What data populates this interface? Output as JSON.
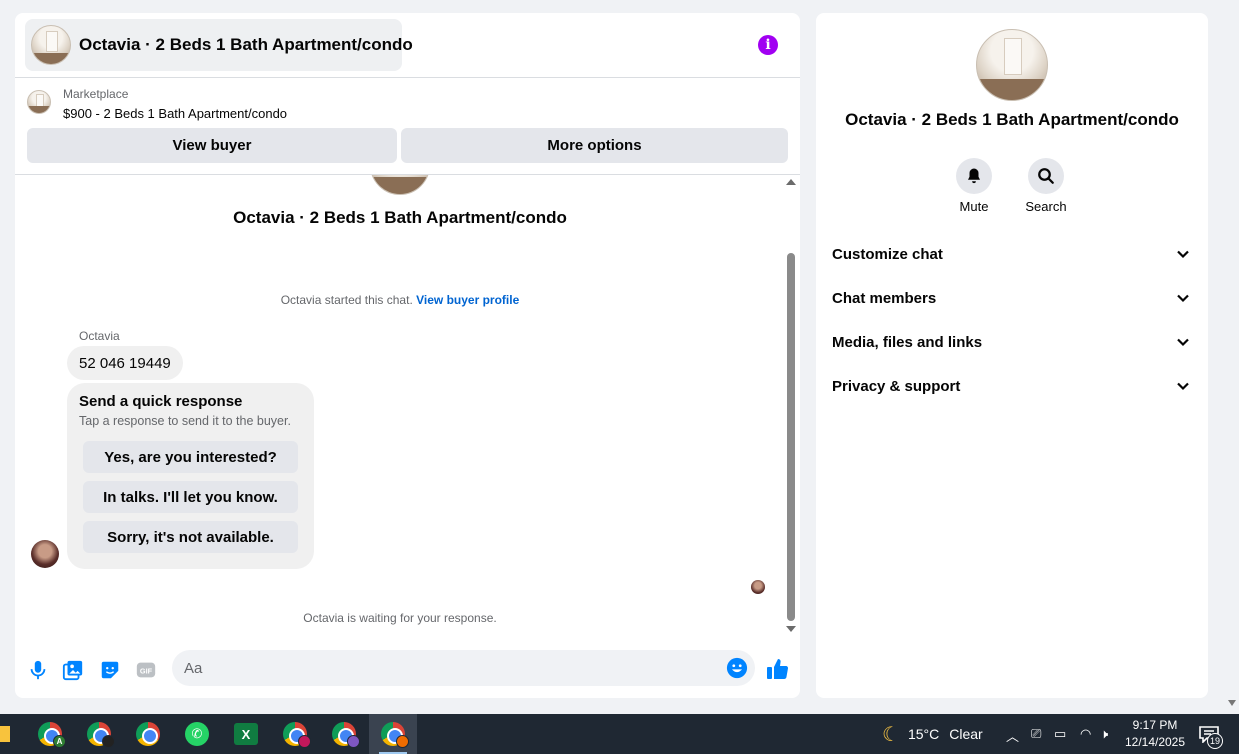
{
  "header": {
    "title": "Octavia · 2 Beds 1 Bath Apartment/condo",
    "avatar_icon": "apartment-photo",
    "info_icon": "info-icon",
    "accent_color": "#a100f2"
  },
  "marketplace": {
    "label": "Marketplace",
    "listing": "$900 - 2 Beds 1 Bath Apartment/condo",
    "view_buyer_label": "View buyer",
    "more_options_label": "More options"
  },
  "thread": {
    "title": "Octavia · 2 Beds 1 Bath Apartment/condo",
    "started_text": "Octavia started this chat.",
    "started_link": "View buyer profile",
    "sender_name": "Octavia",
    "message": "52 046 19449",
    "quick_response": {
      "title": "Send a quick response",
      "subtitle": "Tap a response to send it to the buyer.",
      "options": [
        "Yes, are you interested?",
        "In talks. I'll let you know.",
        "Sorry, it's not available."
      ]
    },
    "waiting_text": "Octavia is waiting for your response."
  },
  "composer": {
    "placeholder": "Aa",
    "icons": [
      "mic-icon",
      "image-icon",
      "sticker-icon",
      "gif-icon",
      "emoji-icon",
      "thumbs-up-icon"
    ],
    "accent_color": "#0084ff"
  },
  "info_panel": {
    "title": "Octavia · 2 Beds 1 Bath Apartment/condo",
    "actions": [
      {
        "label": "Mute",
        "icon": "bell-icon"
      },
      {
        "label": "Search",
        "icon": "search-icon"
      }
    ],
    "sections": [
      "Customize chat",
      "Chat members",
      "Media, files and links",
      "Privacy & support"
    ]
  },
  "taskbar": {
    "weather_temp": "15°C",
    "weather_text": "Clear",
    "time": "9:17 PM",
    "date": "12/14/2025",
    "notification_count": "19",
    "excel_letter": "X"
  }
}
